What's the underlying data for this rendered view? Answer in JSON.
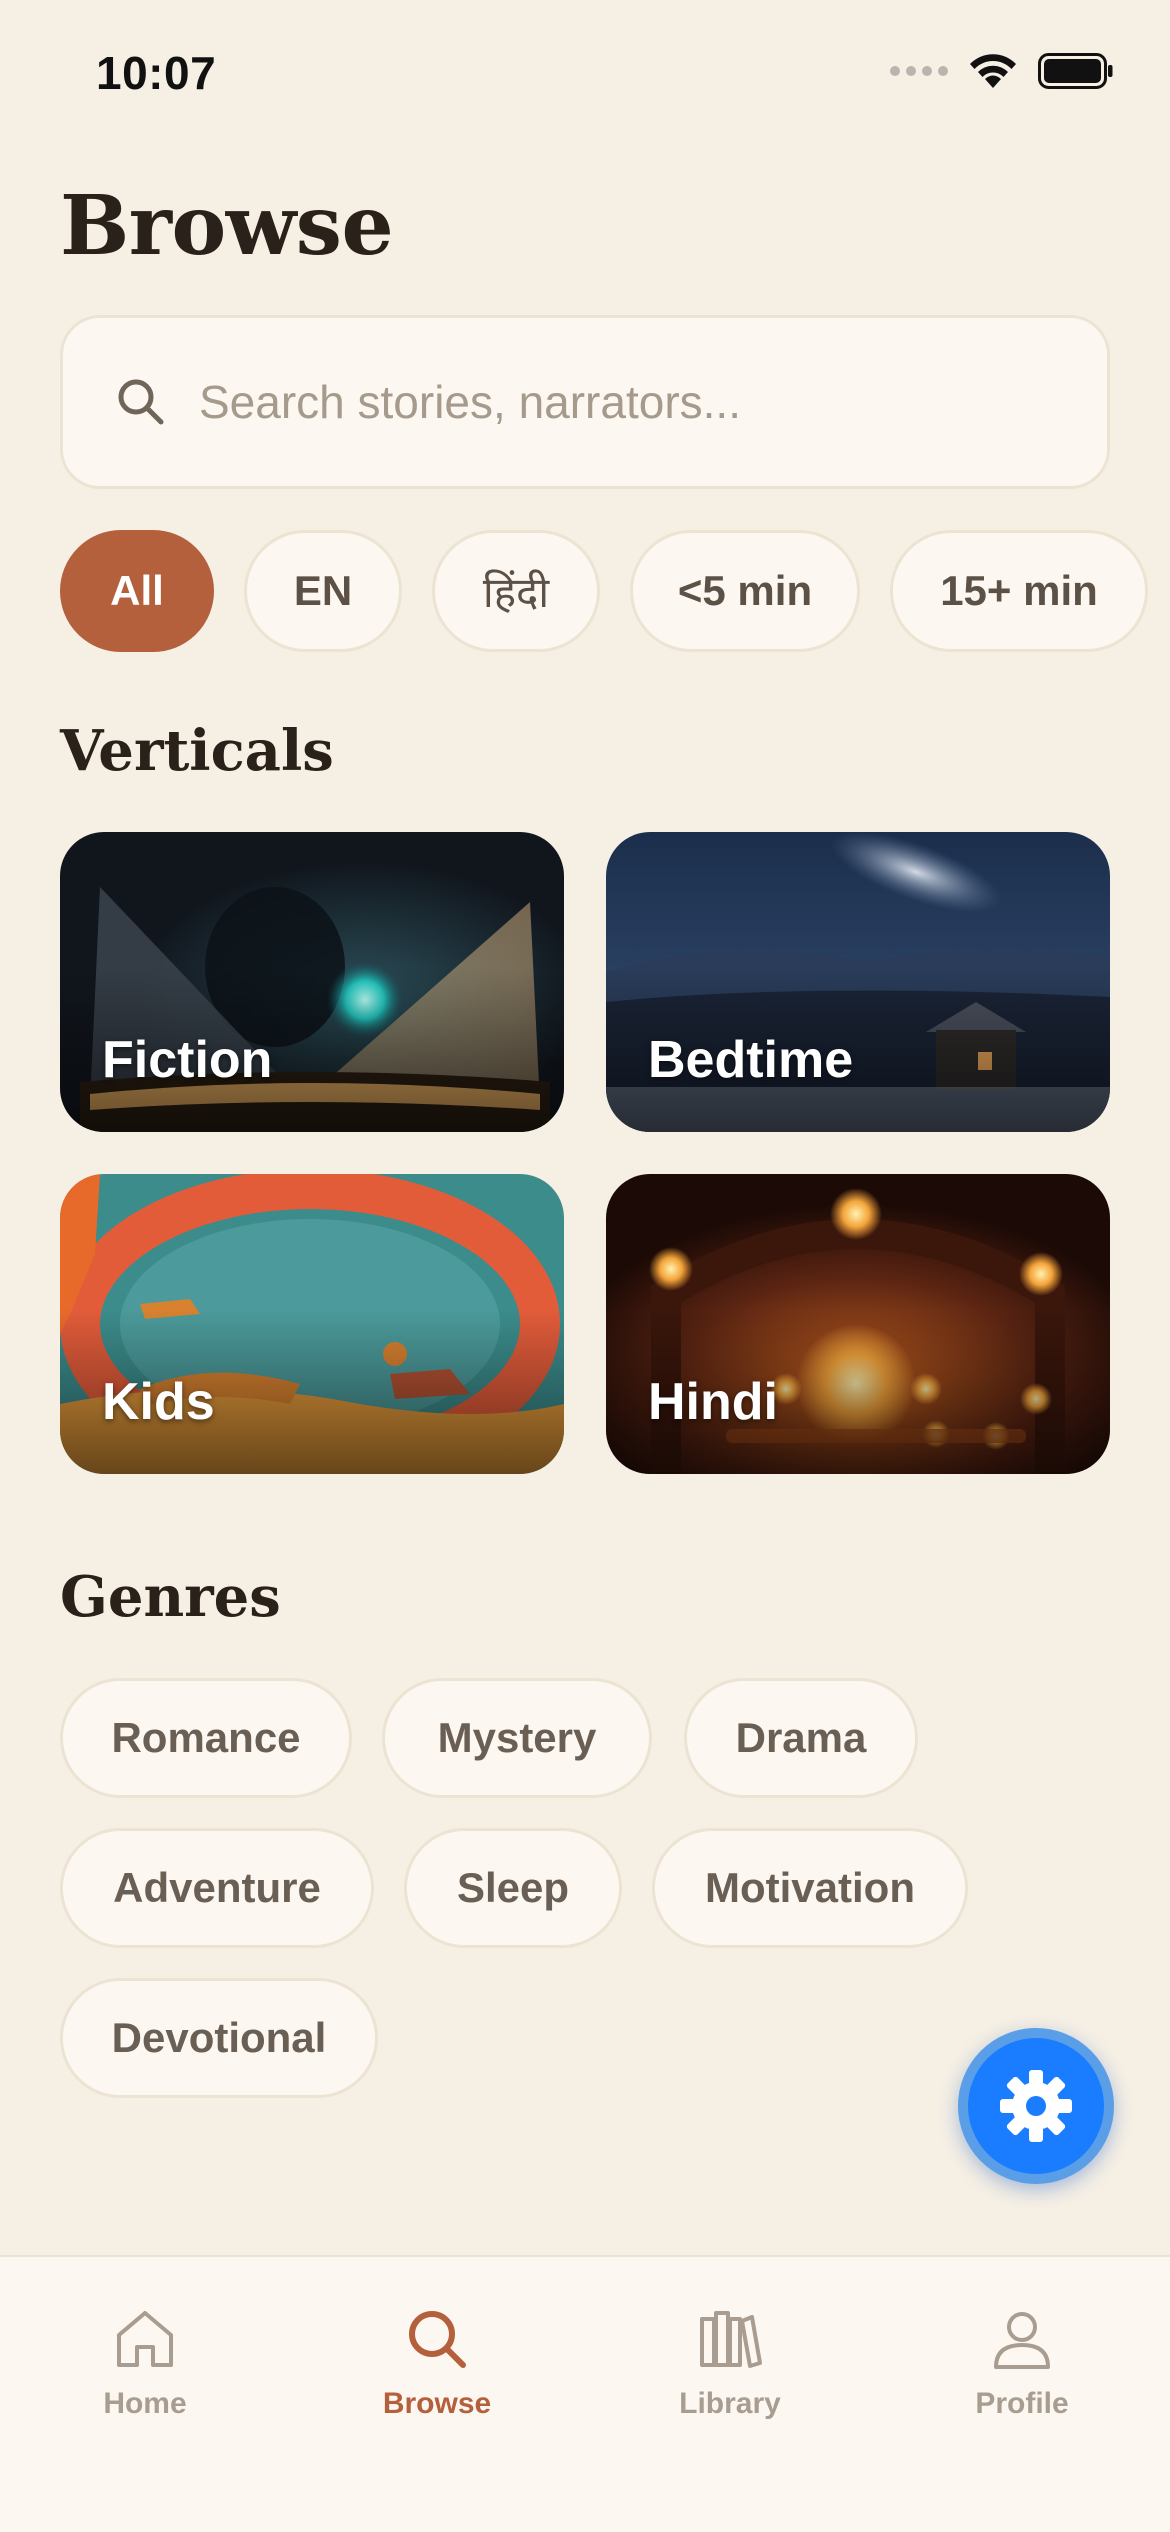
{
  "status_bar": {
    "time": "10:07"
  },
  "header": {
    "title": "Browse"
  },
  "search": {
    "placeholder": "Search stories, narrators..."
  },
  "filters": [
    {
      "label": "All",
      "active": true
    },
    {
      "label": "EN",
      "active": false
    },
    {
      "label": "हिंदी",
      "active": false
    },
    {
      "label": "<5 min",
      "active": false
    },
    {
      "label": "15+ min",
      "active": false
    }
  ],
  "verticals": {
    "title": "Verticals",
    "cards": [
      {
        "label": "Fiction"
      },
      {
        "label": "Bedtime"
      },
      {
        "label": "Kids"
      },
      {
        "label": "Hindi"
      }
    ]
  },
  "genres": {
    "title": "Genres",
    "items": [
      "Romance",
      "Mystery",
      "Drama",
      "Adventure",
      "Sleep",
      "Motivation",
      "Devotional"
    ]
  },
  "tab_bar": {
    "items": [
      {
        "label": "Home",
        "icon": "home-icon",
        "active": false
      },
      {
        "label": "Browse",
        "icon": "search-icon",
        "active": true
      },
      {
        "label": "Library",
        "icon": "library-icon",
        "active": false
      },
      {
        "label": "Profile",
        "icon": "profile-icon",
        "active": false
      }
    ]
  },
  "colors": {
    "accent": "#b5603c",
    "background": "#f5efe4",
    "fab": "#1a7dff"
  }
}
